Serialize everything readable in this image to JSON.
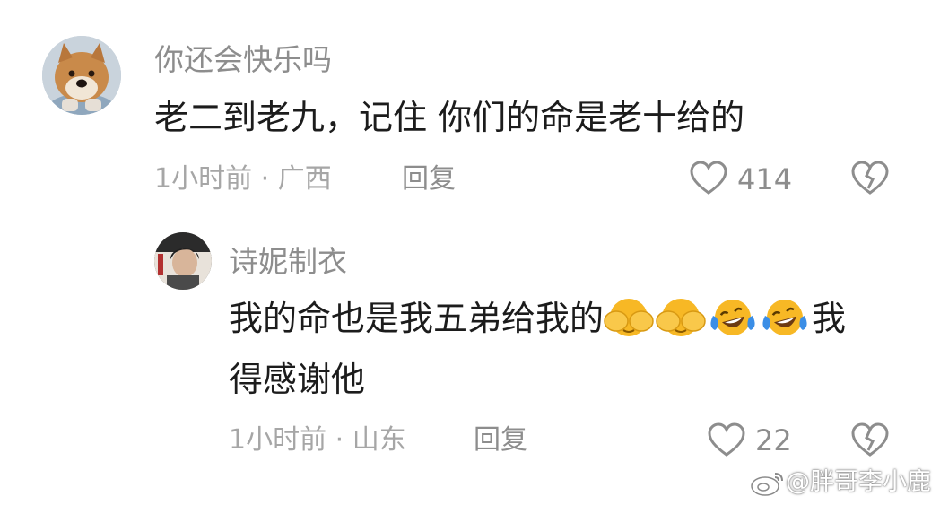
{
  "comments": [
    {
      "username": "你还会快乐吗",
      "text": "老二到老九，记住  你们的命是老十给的",
      "time": "1小时前",
      "sep": "·",
      "location": "广西",
      "reply_label": "回复",
      "like_count": "414"
    },
    {
      "username": "诗妮制衣",
      "text_line1": "我的命也是我五弟给我的",
      "text_line1_end": "我",
      "text_line2": "得感谢他",
      "emojis": [
        "cover-eyes-emoji",
        "cover-eyes-emoji",
        "laughing-tears-emoji",
        "laughing-tears-emoji"
      ],
      "time": "1小时前",
      "sep": "·",
      "location": "山东",
      "reply_label": "回复",
      "like_count": "22"
    }
  ],
  "watermark": {
    "text": "@胖哥李小鹿",
    "icon": "weibo-icon"
  },
  "colors": {
    "text": "#1c1c1c",
    "secondary": "#8d8d8d",
    "meta": "#a6a6a6",
    "emoji_yellow": "#f7b825",
    "emoji_tears": "#3b8ee6"
  }
}
